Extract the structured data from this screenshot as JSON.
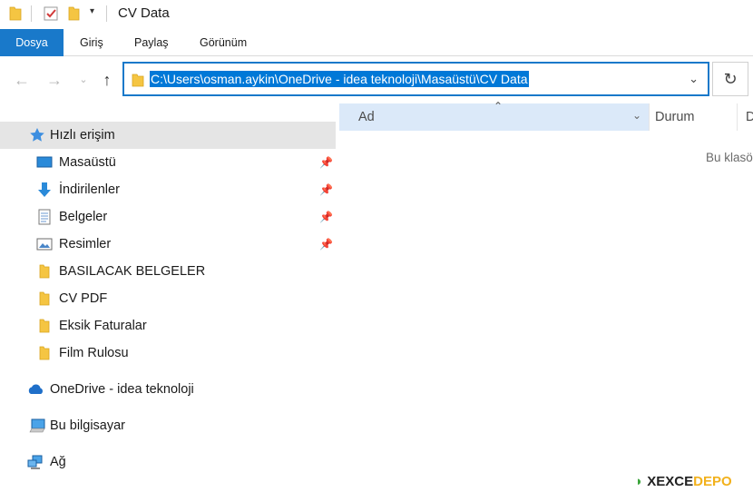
{
  "window": {
    "title": "CV Data"
  },
  "ribbon": {
    "tabs": [
      "Dosya",
      "Giriş",
      "Paylaş",
      "Görünüm"
    ]
  },
  "address": {
    "path": "C:\\Users\\osman.aykin\\OneDrive - idea teknoloji\\Masaüstü\\CV Data"
  },
  "nav": {
    "quick_access": "Hızlı erişim",
    "pinned": [
      "Masaüstü",
      "İndirilenler",
      "Belgeler",
      "Resimler"
    ],
    "folders": [
      "BASILACAK BELGELER",
      "CV PDF",
      "Eksik Faturalar",
      "Film Rulosu"
    ],
    "onedrive": "OneDrive - idea teknoloji",
    "this_pc": "Bu bilgisayar",
    "network": "Ağ"
  },
  "columns": {
    "name": "Ad",
    "status": "Durum",
    "date": "D"
  },
  "content": {
    "empty_message": "Bu klasö"
  },
  "watermark": {
    "part1": "X",
    "part2": "EXCE",
    "part3": "DEPO"
  },
  "colors": {
    "accent": "#1979ca",
    "selection": "#0078d7",
    "header_hover": "#dbe9f9"
  }
}
